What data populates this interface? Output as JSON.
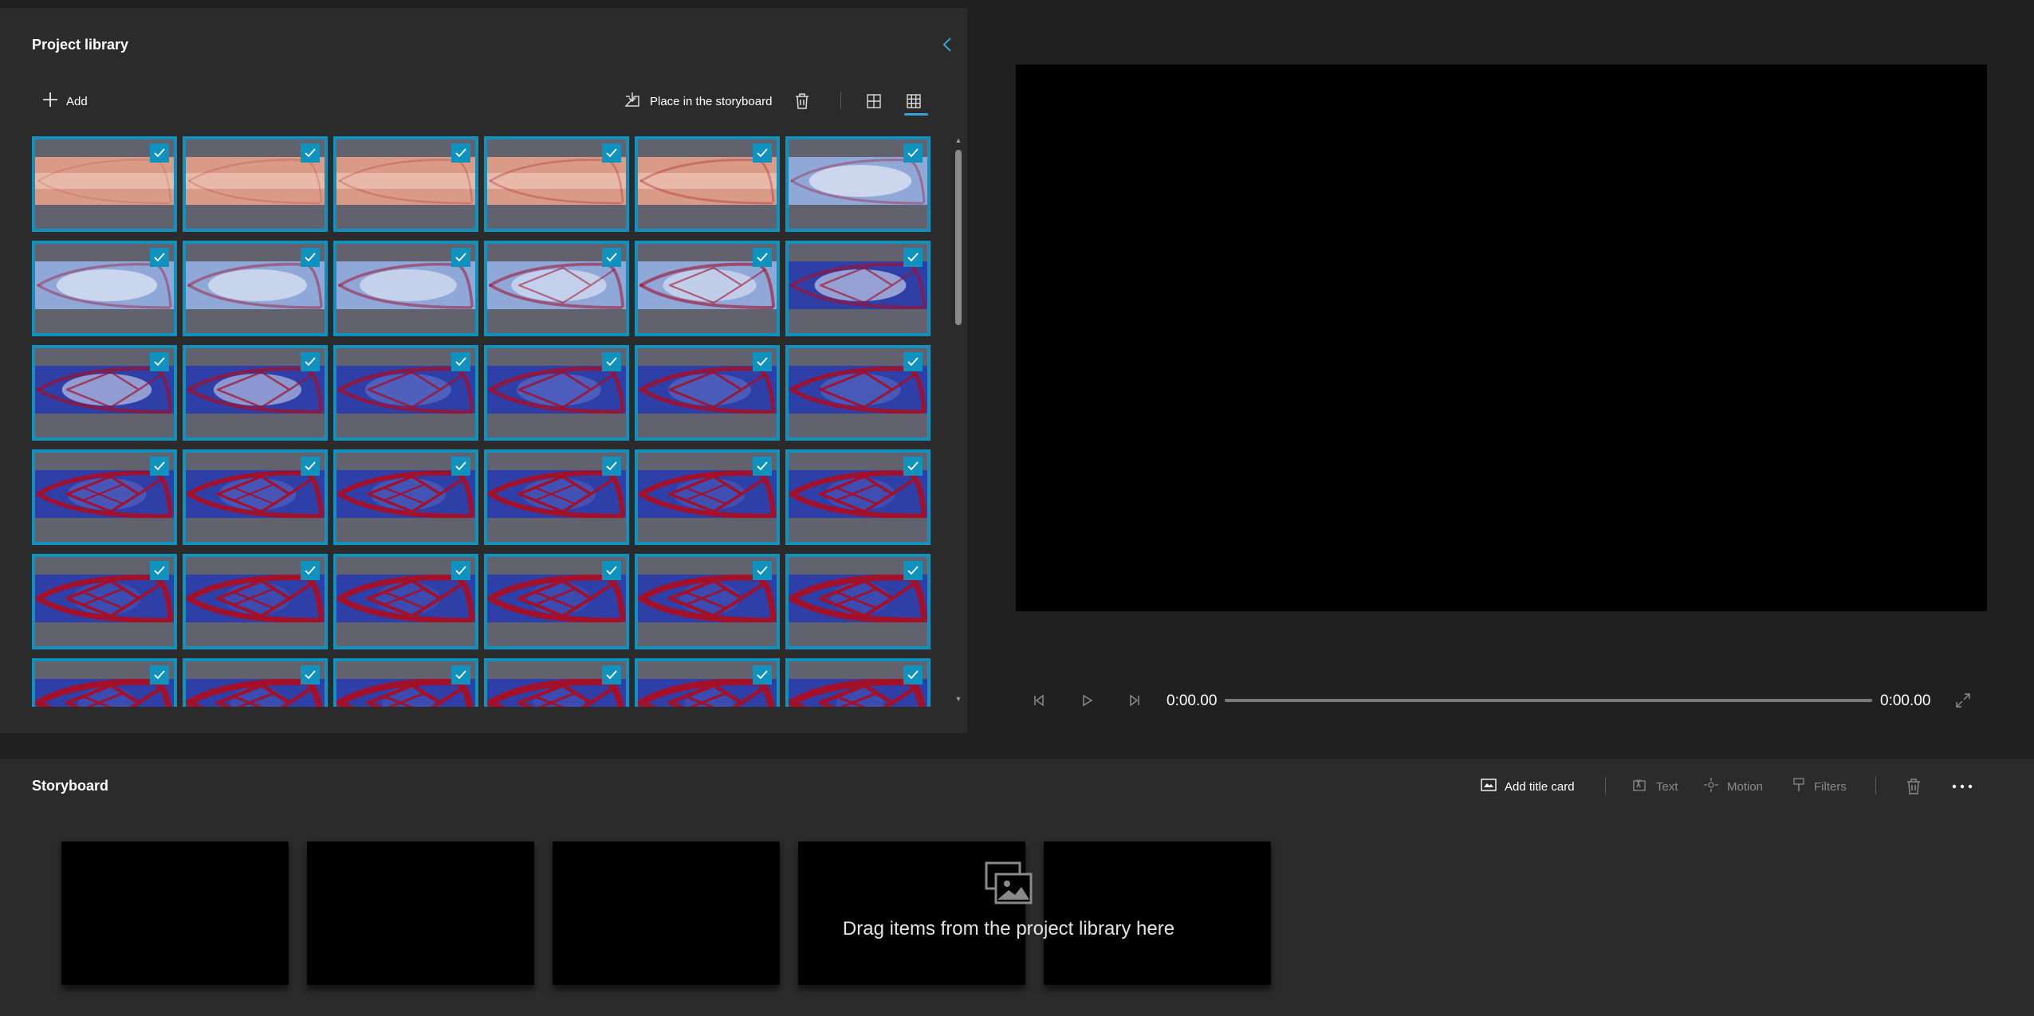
{
  "library": {
    "title": "Project library",
    "add_label": "Add",
    "place_label": "Place in the storyboard",
    "thumbnail_count": 36,
    "all_selected": true
  },
  "preview": {
    "current_time": "0:00.00",
    "total_time": "0:00.00"
  },
  "storyboard": {
    "title": "Storyboard",
    "add_title_card_label": "Add title card",
    "text_label": "Text",
    "motion_label": "Motion",
    "filters_label": "Filters",
    "drop_hint": "Drag items from the project library here",
    "clip_count": 5
  },
  "colors": {
    "selection_accent": "#0f93be",
    "panel_bg": "#2b2b2b",
    "app_bg": "#202020"
  }
}
